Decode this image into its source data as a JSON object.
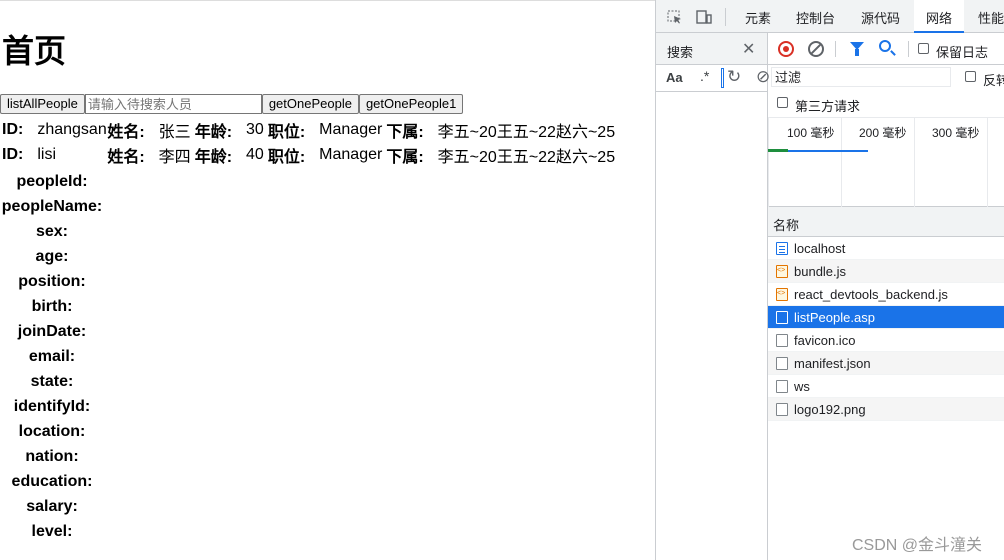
{
  "page": {
    "title": "首页",
    "buttons": {
      "list_all": "listAllPeople",
      "get_one": "getOnePeople",
      "get_one1": "getOnePeople1"
    },
    "search_placeholder": "请输入待搜索人员",
    "rows": [
      {
        "id_label": "ID:",
        "id": "zhangsan",
        "name_label": "姓名:",
        "name": "张三",
        "age_label": "年龄:",
        "age": "30",
        "pos_label": "职位:",
        "pos": "Manager",
        "sub_label": "下属:",
        "subs": "李五~20王五~22赵六~25"
      },
      {
        "id_label": "ID:",
        "id": "lisi",
        "name_label": "姓名:",
        "name": "李四",
        "age_label": "年龄:",
        "age": "40",
        "pos_label": "职位:",
        "pos": "Manager",
        "sub_label": "下属:",
        "subs": "李五~20王五~22赵六~25"
      }
    ],
    "fields": [
      "peopleId:",
      "peopleName:",
      "sex:",
      "age:",
      "position:",
      "birth:",
      "joinDate:",
      "email:",
      "state:",
      "identifyId:",
      "location:",
      "nation:",
      "education:",
      "salary:",
      "level:"
    ]
  },
  "devtools": {
    "tabs": [
      "元素",
      "控制台",
      "源代码",
      "网络",
      "性能"
    ],
    "active_tab": "网络",
    "search_drawer": {
      "title": "搜索",
      "aa": "Aa",
      "regex": ".*"
    },
    "network": {
      "preserve_log": "保留日志",
      "filter_placeholder": "过滤",
      "invert": "反转",
      "third_party": "第三方请求",
      "timeline_ticks": [
        "100 毫秒",
        "200 毫秒",
        "300 毫秒"
      ],
      "name_header": "名称",
      "requests": [
        {
          "name": "localhost",
          "type": "doc"
        },
        {
          "name": "bundle.js",
          "type": "js"
        },
        {
          "name": "react_devtools_backend.js",
          "type": "js"
        },
        {
          "name": "listPeople.asp",
          "type": "other",
          "selected": true
        },
        {
          "name": "favicon.ico",
          "type": "other"
        },
        {
          "name": "manifest.json",
          "type": "other"
        },
        {
          "name": "ws",
          "type": "other"
        },
        {
          "name": "logo192.png",
          "type": "other"
        }
      ]
    }
  },
  "watermark": "CSDN @金斗潼关",
  "colors": {
    "accent": "#1a73e8",
    "record": "#d93025"
  }
}
